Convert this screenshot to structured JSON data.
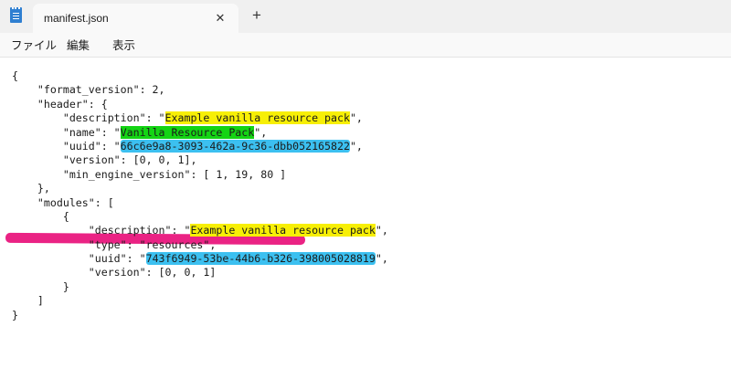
{
  "window": {
    "tab_title": "manifest.json",
    "close_glyph": "✕",
    "new_tab_glyph": "+",
    "app_icon": "notepad-icon"
  },
  "menu": {
    "items": [
      "ファイル",
      "編集",
      "表示"
    ]
  },
  "editor": {
    "lines": [
      {
        "segments": [
          {
            "text": "{"
          }
        ]
      },
      {
        "segments": [
          {
            "text": "    \"format_version\": 2,"
          }
        ]
      },
      {
        "segments": [
          {
            "text": "    \"header\": {"
          }
        ]
      },
      {
        "segments": [
          {
            "text": "        \"description\": \""
          },
          {
            "text": "Example vanilla resource pack",
            "hl": "yellow"
          },
          {
            "text": "\","
          }
        ]
      },
      {
        "segments": [
          {
            "text": "        \"name\": \""
          },
          {
            "text": "Vanilla Resource Pack",
            "hl": "green"
          },
          {
            "text": "\","
          }
        ]
      },
      {
        "segments": [
          {
            "text": "        \"uuid\": \""
          },
          {
            "text": "66c6e9a8-3093-462a-9c36-dbb052165822",
            "hl": "blue"
          },
          {
            "text": "\","
          }
        ]
      },
      {
        "segments": [
          {
            "text": "        \"version\": [0, 0, 1],"
          }
        ]
      },
      {
        "segments": [
          {
            "text": "        \"min_engine_version\": [ 1, 19, 80 ]"
          }
        ]
      },
      {
        "segments": [
          {
            "text": "    },"
          }
        ]
      },
      {
        "segments": [
          {
            "text": "    \"modules\": ["
          }
        ]
      },
      {
        "segments": [
          {
            "text": "        {"
          }
        ]
      },
      {
        "segments": [
          {
            "text": "            \"description\": \""
          },
          {
            "text": "Example vanilla resource pack",
            "hl": "yellow"
          },
          {
            "text": "\","
          }
        ]
      },
      {
        "segments": [
          {
            "text": "            \"type\": \"resources\","
          }
        ]
      },
      {
        "segments": [
          {
            "text": "            \"uuid\": \""
          },
          {
            "text": "743f6949-53be-44b6-b326-398005028819",
            "hl": "blue"
          },
          {
            "text": "\","
          }
        ]
      },
      {
        "segments": [
          {
            "text": "            \"version\": [0, 0, 1]"
          }
        ]
      },
      {
        "segments": [
          {
            "text": "        }"
          }
        ]
      },
      {
        "segments": [
          {
            "text": "    ]"
          }
        ]
      },
      {
        "segments": [
          {
            "text": "}"
          }
        ]
      }
    ]
  },
  "colors": {
    "highlight_yellow": "#f7ef05",
    "highlight_green": "#14d414",
    "highlight_blue": "#3cc0f0",
    "strike_pink": "#e8107a"
  }
}
